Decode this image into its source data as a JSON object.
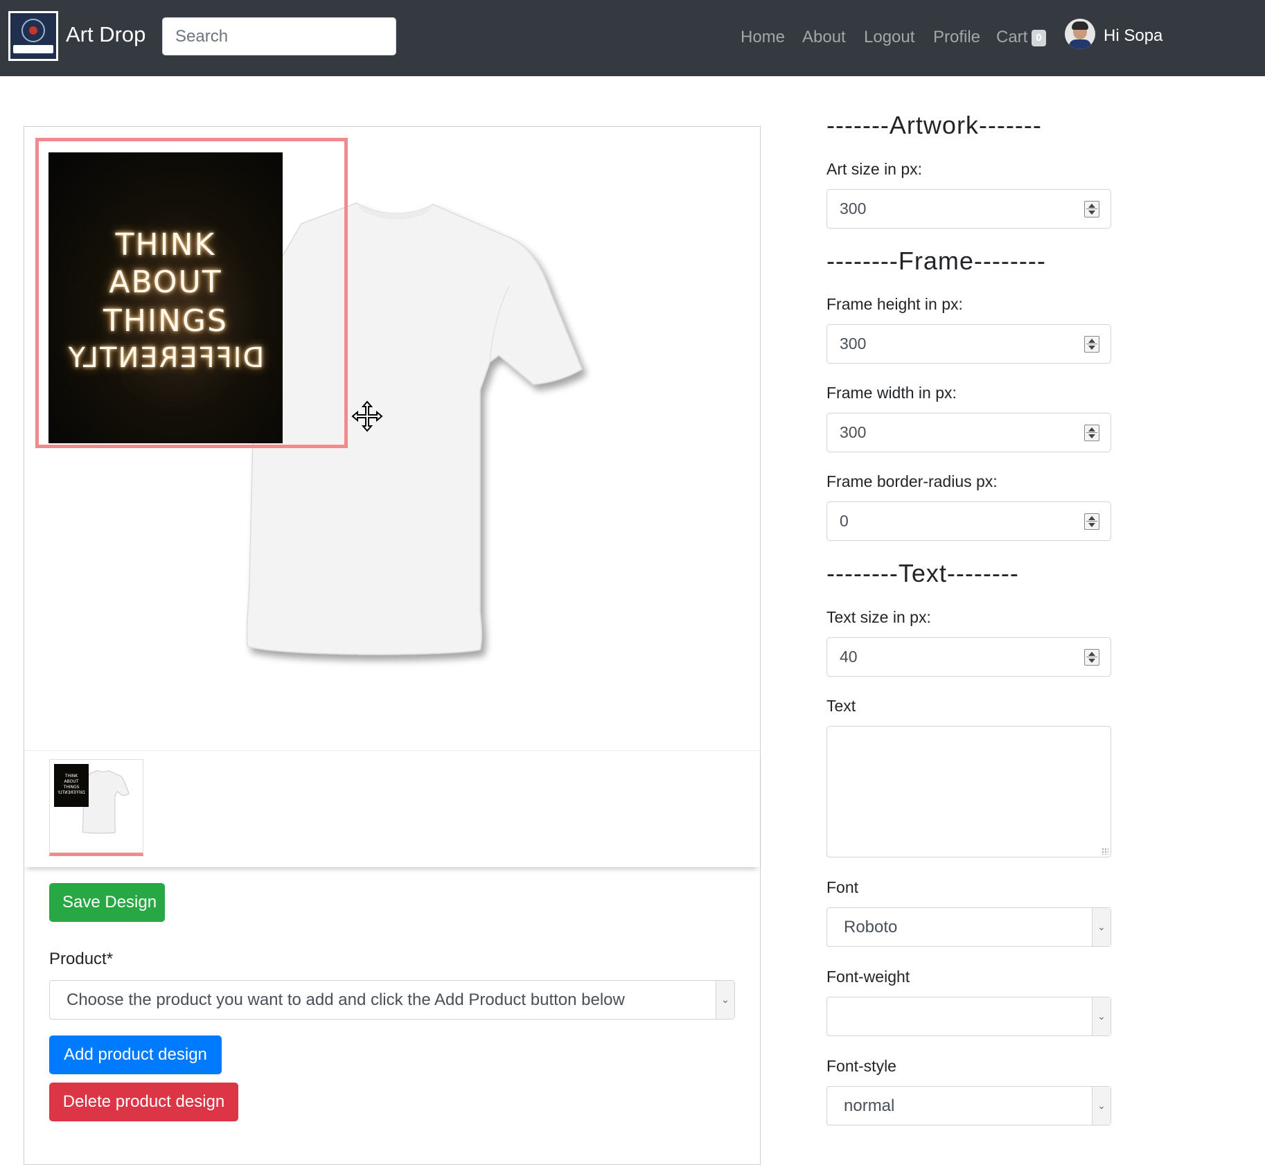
{
  "navbar": {
    "brand": "Art Drop",
    "search_placeholder": "Search",
    "links": [
      "Home",
      "About",
      "Logout",
      "Profile",
      "Cart"
    ],
    "cart_count": "0",
    "greeting": "Hi Sopa"
  },
  "design": {
    "artwork_text": [
      "THINK",
      "ABOUT",
      "THINGS",
      "DIFFERENTLY"
    ],
    "save_label": "Save Design",
    "product_label": "Product*",
    "product_select_value": "Choose the product you want to add and click the Add Product button below",
    "add_label": "Add product design",
    "delete_label": "Delete product design"
  },
  "settings": {
    "artwork_title": "-------Artwork-------",
    "art_size_label": "Art size in px:",
    "art_size": "300",
    "frame_title": "--------Frame--------",
    "frame_height_label": "Frame height in px:",
    "frame_height": "300",
    "frame_width_label": "Frame width in px:",
    "frame_width": "300",
    "frame_radius_label": "Frame border-radius px:",
    "frame_radius": "0",
    "text_title": "--------Text--------",
    "text_size_label": "Text size in px:",
    "text_size": "40",
    "text_label": "Text",
    "text_value": "",
    "font_label": "Font",
    "font_value": "Roboto",
    "font_weight_label": "Font-weight",
    "font_weight_value": "",
    "font_style_label": "Font-style",
    "font_style_value": "normal"
  },
  "colors": {
    "navbar_bg": "#343a40",
    "save": "#28a745",
    "add": "#007bff",
    "delete": "#dc3545",
    "frame_highlight": "#f08a8c"
  }
}
